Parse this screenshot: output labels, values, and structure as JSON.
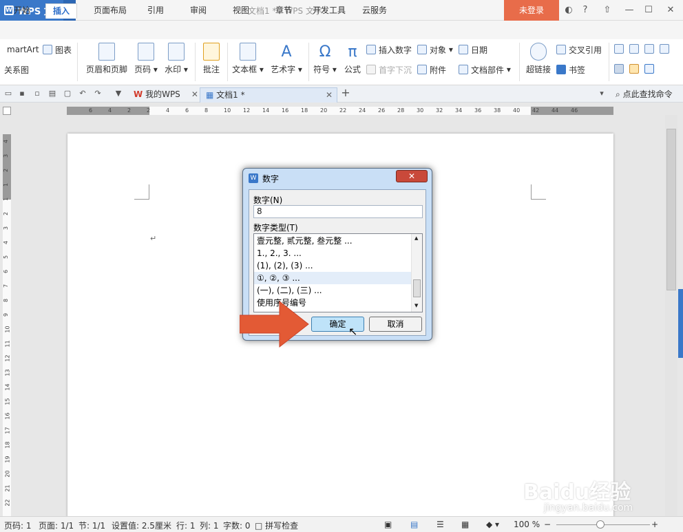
{
  "app": {
    "name": "WPS 文字",
    "window_title": "文档1 * - WPS 文字",
    "login": "未登录"
  },
  "menu_tabs": [
    "开始",
    "插入",
    "页面布局",
    "引用",
    "审阅",
    "视图",
    "章节",
    "开发工具",
    "云服务"
  ],
  "ribbon": {
    "smartart": "martArt",
    "chart": "图表",
    "relation": "关系图",
    "header_footer": "页眉和页脚",
    "page_number": "页码",
    "watermark": "水印",
    "comment": "批注",
    "textbox": "文本框",
    "wordart": "艺术字",
    "symbol": "符号",
    "formula": "公式",
    "insert_number": "插入数字",
    "object": "对象",
    "date": "日期",
    "dropcap": "首字下沉",
    "attachment": "附件",
    "doc_parts": "文档部件",
    "hyperlink": "超链接",
    "cross_ref": "交叉引用",
    "bookmark": "书签"
  },
  "doc_tabs": [
    "我的WPS",
    "文档1 *"
  ],
  "search_cmd": "点此查找命令",
  "ruler_h": [
    "6",
    "4",
    "2",
    "2",
    "4",
    "6",
    "8",
    "10",
    "12",
    "14",
    "16",
    "18",
    "20",
    "22",
    "24",
    "26",
    "28",
    "30",
    "32",
    "34",
    "36",
    "38",
    "40",
    "42",
    "44",
    "46"
  ],
  "ruler_v": [
    "4",
    "3",
    "2",
    "1",
    "1",
    "2",
    "3",
    "4",
    "5",
    "6",
    "7",
    "8",
    "9",
    "10",
    "11",
    "12",
    "13",
    "14",
    "15",
    "16",
    "17",
    "18",
    "19",
    "20",
    "21",
    "22"
  ],
  "paragraph_mark": "↵",
  "dialog": {
    "title": "数字",
    "close": "✕",
    "number_label": "数字(N)",
    "number_value": "8",
    "type_label": "数字类型(T)",
    "types": [
      "壹元整, 贰元整, 叁元整 ...",
      "1., 2., 3. ...",
      "(1), (2), (3) ...",
      "①, ②, ③ ...",
      "(一), (二), (三) ...",
      "使用序号编号"
    ],
    "selected_index": 3,
    "ok": "确定",
    "cancel": "取消"
  },
  "status": {
    "page_num": "页码: 1",
    "pages": "页面: 1/1",
    "section": "节: 1/1",
    "setting": "设置值: 2.5厘米",
    "line": "行: 1",
    "col": "列: 1",
    "words": "字数: 0",
    "spell": "拼写检查",
    "zoom": "100 %"
  },
  "watermark": {
    "brand": "Baidu经验",
    "url": "jingyan.baidu.com"
  }
}
